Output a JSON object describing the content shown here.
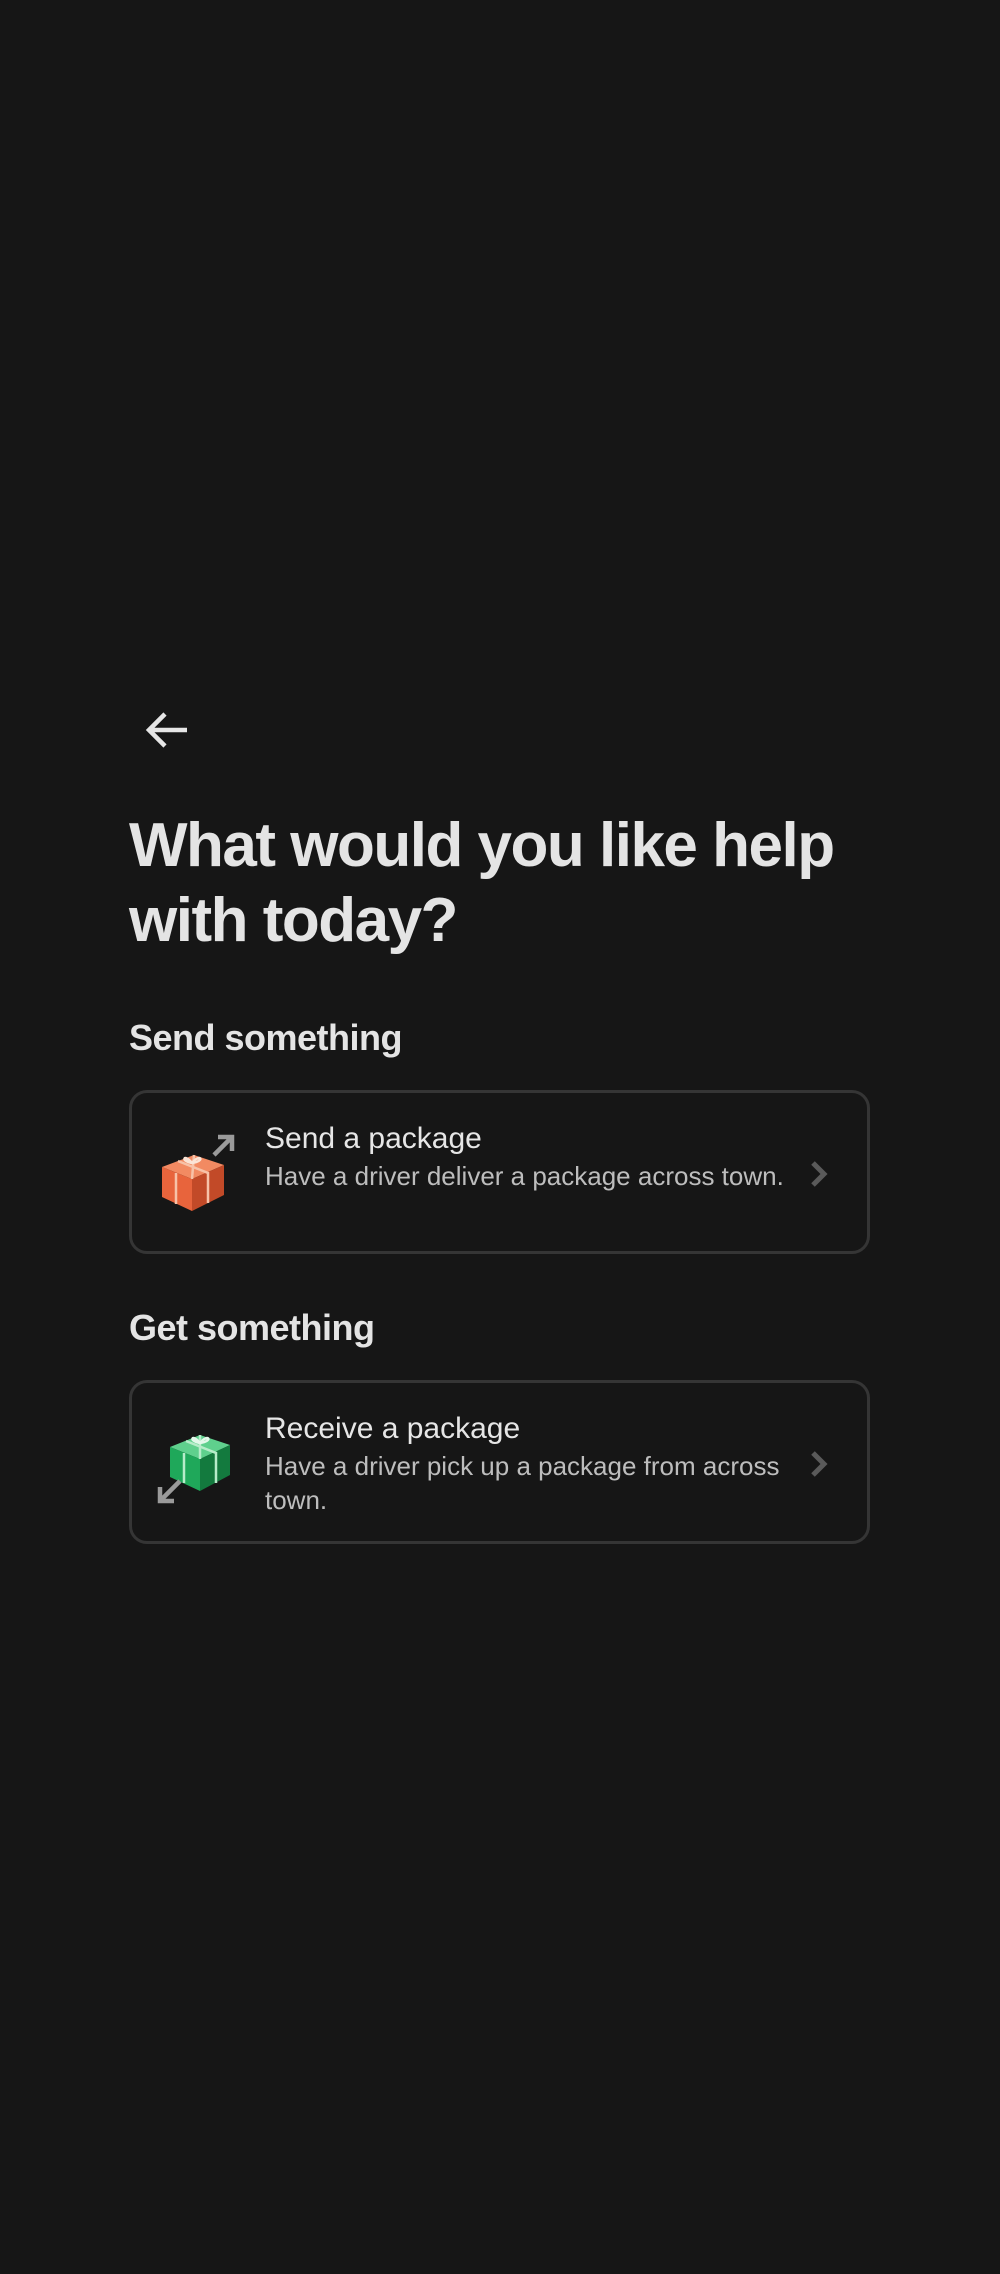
{
  "nav": {
    "back_icon": "arrow-left-icon"
  },
  "page": {
    "title": "What would you like help with today?"
  },
  "sections": [
    {
      "heading": "Send something",
      "option": {
        "title": "Send a package",
        "description": "Have a driver deliver a package across town.",
        "icon": "send-package-icon",
        "accent": "#e8643c"
      }
    },
    {
      "heading": "Get something",
      "option": {
        "title": "Receive a package",
        "description": "Have a driver pick up a package from across town.",
        "icon": "receive-package-icon",
        "accent": "#1fa85a"
      }
    }
  ],
  "colors": {
    "background": "#161616",
    "text": "#e4e4e4",
    "muted_text": "#bdbdbd",
    "card_border": "#353535",
    "chevron": "#5a5a5a"
  }
}
